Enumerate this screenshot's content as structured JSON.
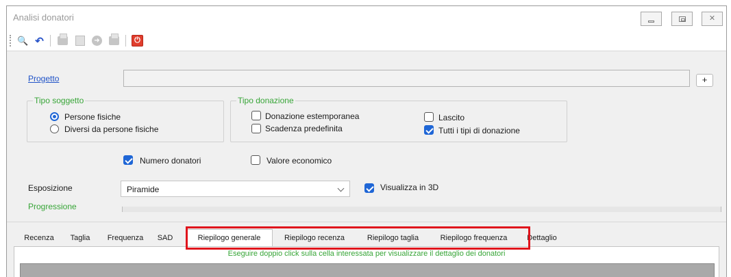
{
  "window": {
    "title": "Analisi donatori",
    "controls": {
      "minimize": "minimize",
      "maximize": "maximize",
      "close_glyph": "✕"
    }
  },
  "toolbar": {
    "icons": [
      "binoculars-icon",
      "undo-icon",
      "print-icon",
      "sheet-icon",
      "next-icon",
      "print-preview-icon",
      "power-off-icon"
    ],
    "search_glyph": "🔍",
    "undo_glyph": "↶",
    "next_glyph": "➜",
    "power_glyph": "⏻"
  },
  "form": {
    "progetto_label": "Progetto",
    "progetto_value": "",
    "plus_label": "+",
    "tipo_soggetto": {
      "title": "Tipo soggetto",
      "options": [
        {
          "label": "Persone fisiche",
          "selected": true
        },
        {
          "label": "Diversi da persone fisiche",
          "selected": false
        }
      ]
    },
    "tipo_donazione": {
      "title": "Tipo donazione",
      "options": [
        {
          "label": "Donazione estemporanea",
          "checked": false
        },
        {
          "label": "Scadenza predefinita",
          "checked": false
        },
        {
          "label": "Lascito",
          "checked": false
        },
        {
          "label": "Tutti i tipi di donazione",
          "checked": true
        }
      ]
    },
    "numero_donatori": {
      "label": "Numero donatori",
      "checked": true
    },
    "valore_economico": {
      "label": "Valore economico",
      "checked": false
    },
    "esposizione_label": "Esposizione",
    "esposizione_value": "Piramide",
    "visualizza_3d": {
      "label": "Visualizza in 3D",
      "checked": true
    },
    "progressione_label": "Progressione",
    "progressione_value": 0
  },
  "tabs": [
    {
      "label": "Recenza",
      "active": false
    },
    {
      "label": "Taglia",
      "active": false
    },
    {
      "label": "Frequenza",
      "active": false
    },
    {
      "label": "SAD",
      "active": false
    },
    {
      "label": "Riepilogo generale",
      "active": true
    },
    {
      "label": "Riepilogo recenza",
      "active": false
    },
    {
      "label": "Riepilogo taglia",
      "active": false
    },
    {
      "label": "Riepilogo frequenza",
      "active": false
    },
    {
      "label": "Dettaglio",
      "active": false
    }
  ],
  "content": {
    "hint": "Eseguire doppio click sulla cella interessata per visualizzare il dettaglio dei donatori"
  },
  "colors": {
    "accent": "#1f66d6",
    "green_label": "#37a537",
    "link": "#1f52c7",
    "highlight": "#e0141c",
    "power": "#e03d2d"
  }
}
